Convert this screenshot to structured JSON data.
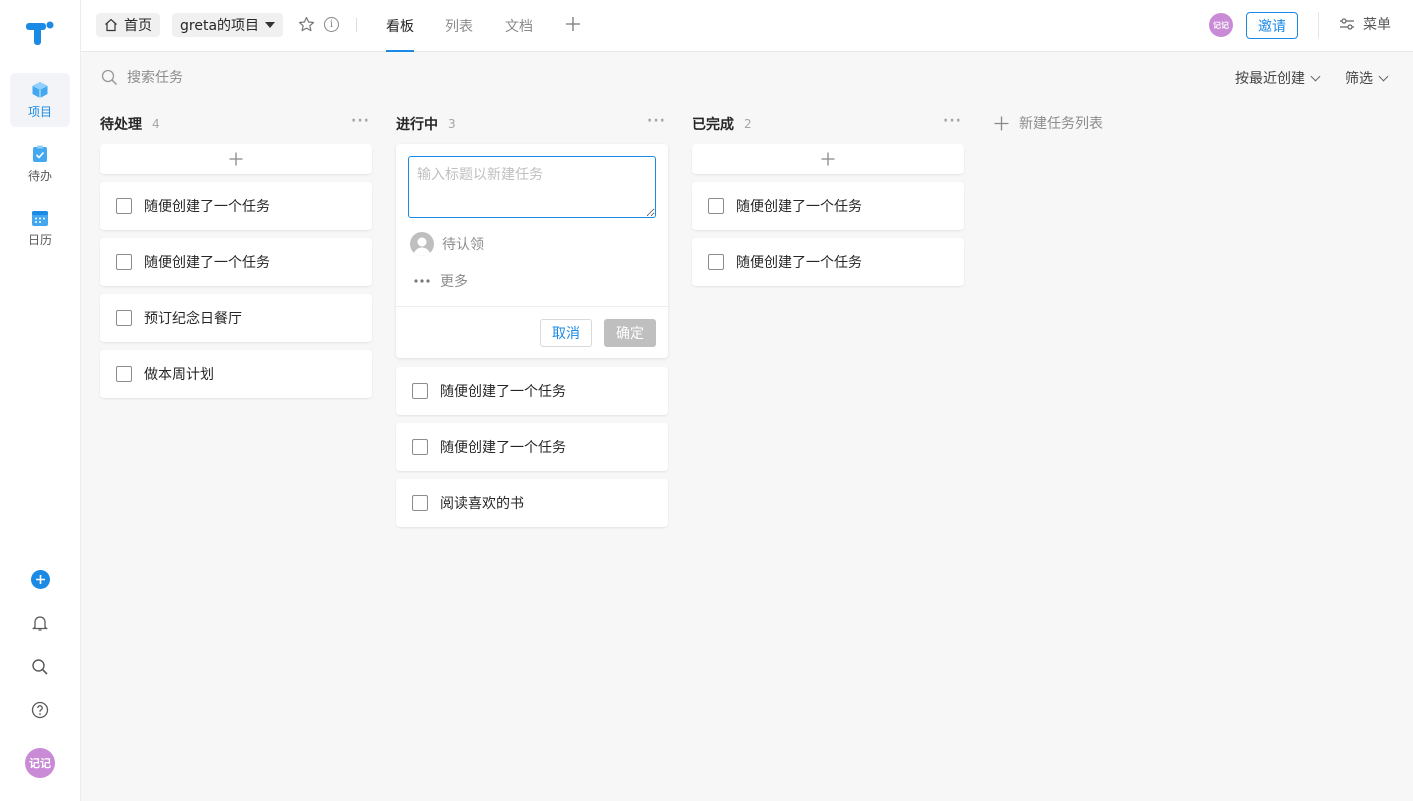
{
  "topbar": {
    "home_label": "首页",
    "project_label": "greta的项目",
    "tabs": [
      {
        "label": "看板",
        "active": true
      },
      {
        "label": "列表",
        "active": false
      },
      {
        "label": "文档",
        "active": false
      }
    ],
    "avatar_label": "记记",
    "invite_label": "邀请",
    "menu_label": "菜单"
  },
  "sidebar": {
    "items": [
      {
        "label": "项目",
        "icon": "cube-icon",
        "active": true
      },
      {
        "label": "待办",
        "icon": "clipboard-check-icon",
        "active": false
      },
      {
        "label": "日历",
        "icon": "calendar-icon",
        "active": false
      }
    ],
    "avatar_label": "记记",
    "accent_color": "#1b8ae5"
  },
  "toolbar": {
    "search_placeholder": "搜索任务",
    "sort_label": "按最近创建",
    "filter_label": "筛选"
  },
  "columns": [
    {
      "title": "待处理",
      "count": "4",
      "tasks": [
        "随便创建了一个任务",
        "随便创建了一个任务",
        "预订纪念日餐厅",
        "做本周计划"
      ]
    },
    {
      "title": "进行中",
      "count": "3",
      "editor": {
        "placeholder": "输入标题以新建任务",
        "assignee_label": "待认领",
        "more_label": "更多",
        "cancel_label": "取消",
        "confirm_label": "确定"
      },
      "tasks": [
        "随便创建了一个任务",
        "随便创建了一个任务",
        "阅读喜欢的书"
      ]
    },
    {
      "title": "已完成",
      "count": "2",
      "tasks": [
        "随便创建了一个任务",
        "随便创建了一个任务"
      ]
    }
  ],
  "new_list_label": "新建任务列表"
}
